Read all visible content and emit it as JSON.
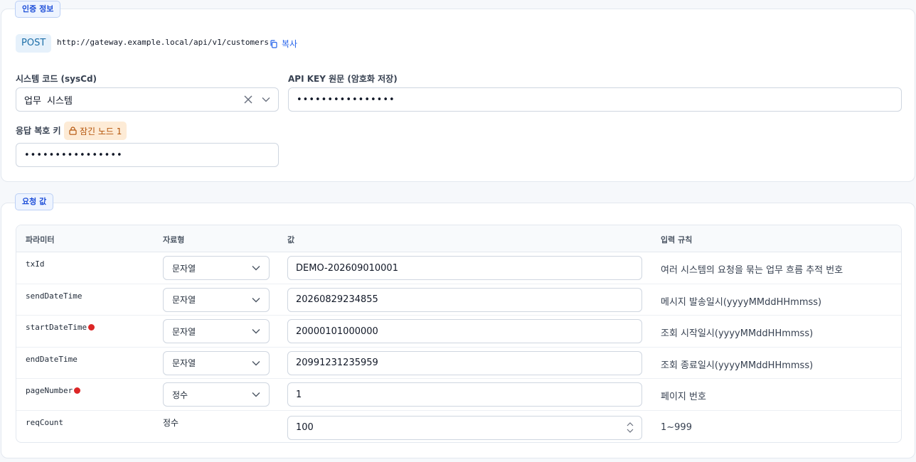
{
  "auth": {
    "section_title": "인증 정보",
    "method": "POST",
    "url": "http://gateway.example.local/api/v1/customers",
    "copy_label": "복사",
    "system_code": {
      "label": "시스템 코드 (sysCd)",
      "value": "업무 시스템"
    },
    "api_key": {
      "label": "API KEY 원문 (암호화 저장)",
      "value": "••••••••••••••••"
    },
    "response_key": {
      "label": "응답 복호 키",
      "badge": "잠긴 노드 1",
      "value": "••••••••••••••••"
    }
  },
  "request": {
    "section_title": "요청 값",
    "columns": {
      "param": "파라미터",
      "type": "자료형",
      "value": "값",
      "rule": "입력 규칙"
    },
    "rows": [
      {
        "param": "txId",
        "type": "문자열",
        "value": "DEMO-202609010001",
        "rule": "여러 시스템의 요청을 묶는 업무 흐름 추적 번호"
      },
      {
        "param": "sendDateTime",
        "type": "문자열",
        "value": "20260829234855",
        "rule": "메시지 발송일시(yyyyMMddHHmmss)"
      },
      {
        "param": "startDateTime",
        "type": "문자열",
        "value": "20000101000000",
        "rule": "조회 시작일시(yyyyMMddHHmmss)"
      },
      {
        "param": "endDateTime",
        "type": "문자열",
        "value": "20991231235959",
        "rule": "조회 종료일시(yyyyMMddHHmmss)"
      },
      {
        "param": "pageNumber",
        "type": "정수",
        "value": "1",
        "rule": "페이지 번호"
      },
      {
        "param": "reqCount",
        "type": "정수",
        "value": "100",
        "rule": "1~999"
      }
    ]
  }
}
